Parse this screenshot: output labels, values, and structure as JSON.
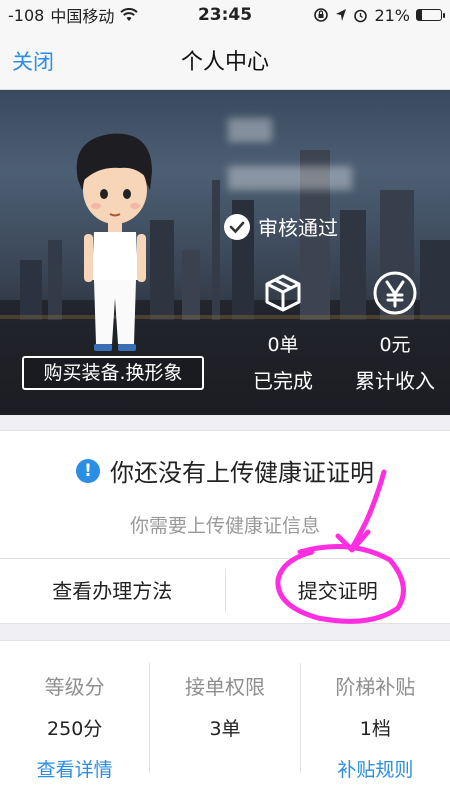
{
  "status_bar": {
    "signal": "-108",
    "carrier": "中国移动",
    "time": "23:45",
    "battery": "21%",
    "battery_level": 0.21
  },
  "nav": {
    "close_label": "关闭",
    "title": "个人中心"
  },
  "profile": {
    "buy_equipment_label": "购买装备.换形象",
    "verify_status": "审核通过",
    "stats": [
      {
        "icon": "package-icon",
        "value": "0单",
        "label": "已完成"
      },
      {
        "icon": "yen-icon",
        "value": "0元",
        "label": "累计收入"
      }
    ]
  },
  "notice": {
    "title": "你还没有上传健康证证明",
    "subtitle": "你需要上传健康证信息"
  },
  "actions": {
    "view_method_label": "查看办理方法",
    "submit_label": "提交证明"
  },
  "bottom": {
    "columns": [
      {
        "label": "等级分",
        "value": "250分",
        "link": "查看详情"
      },
      {
        "label": "接单权限",
        "value": "3单",
        "link": ""
      },
      {
        "label": "阶梯补贴",
        "value": "1档",
        "link": "补贴规则"
      }
    ]
  },
  "colors": {
    "accent": "#2b8ee5",
    "annotation": "#ff2ee0"
  }
}
